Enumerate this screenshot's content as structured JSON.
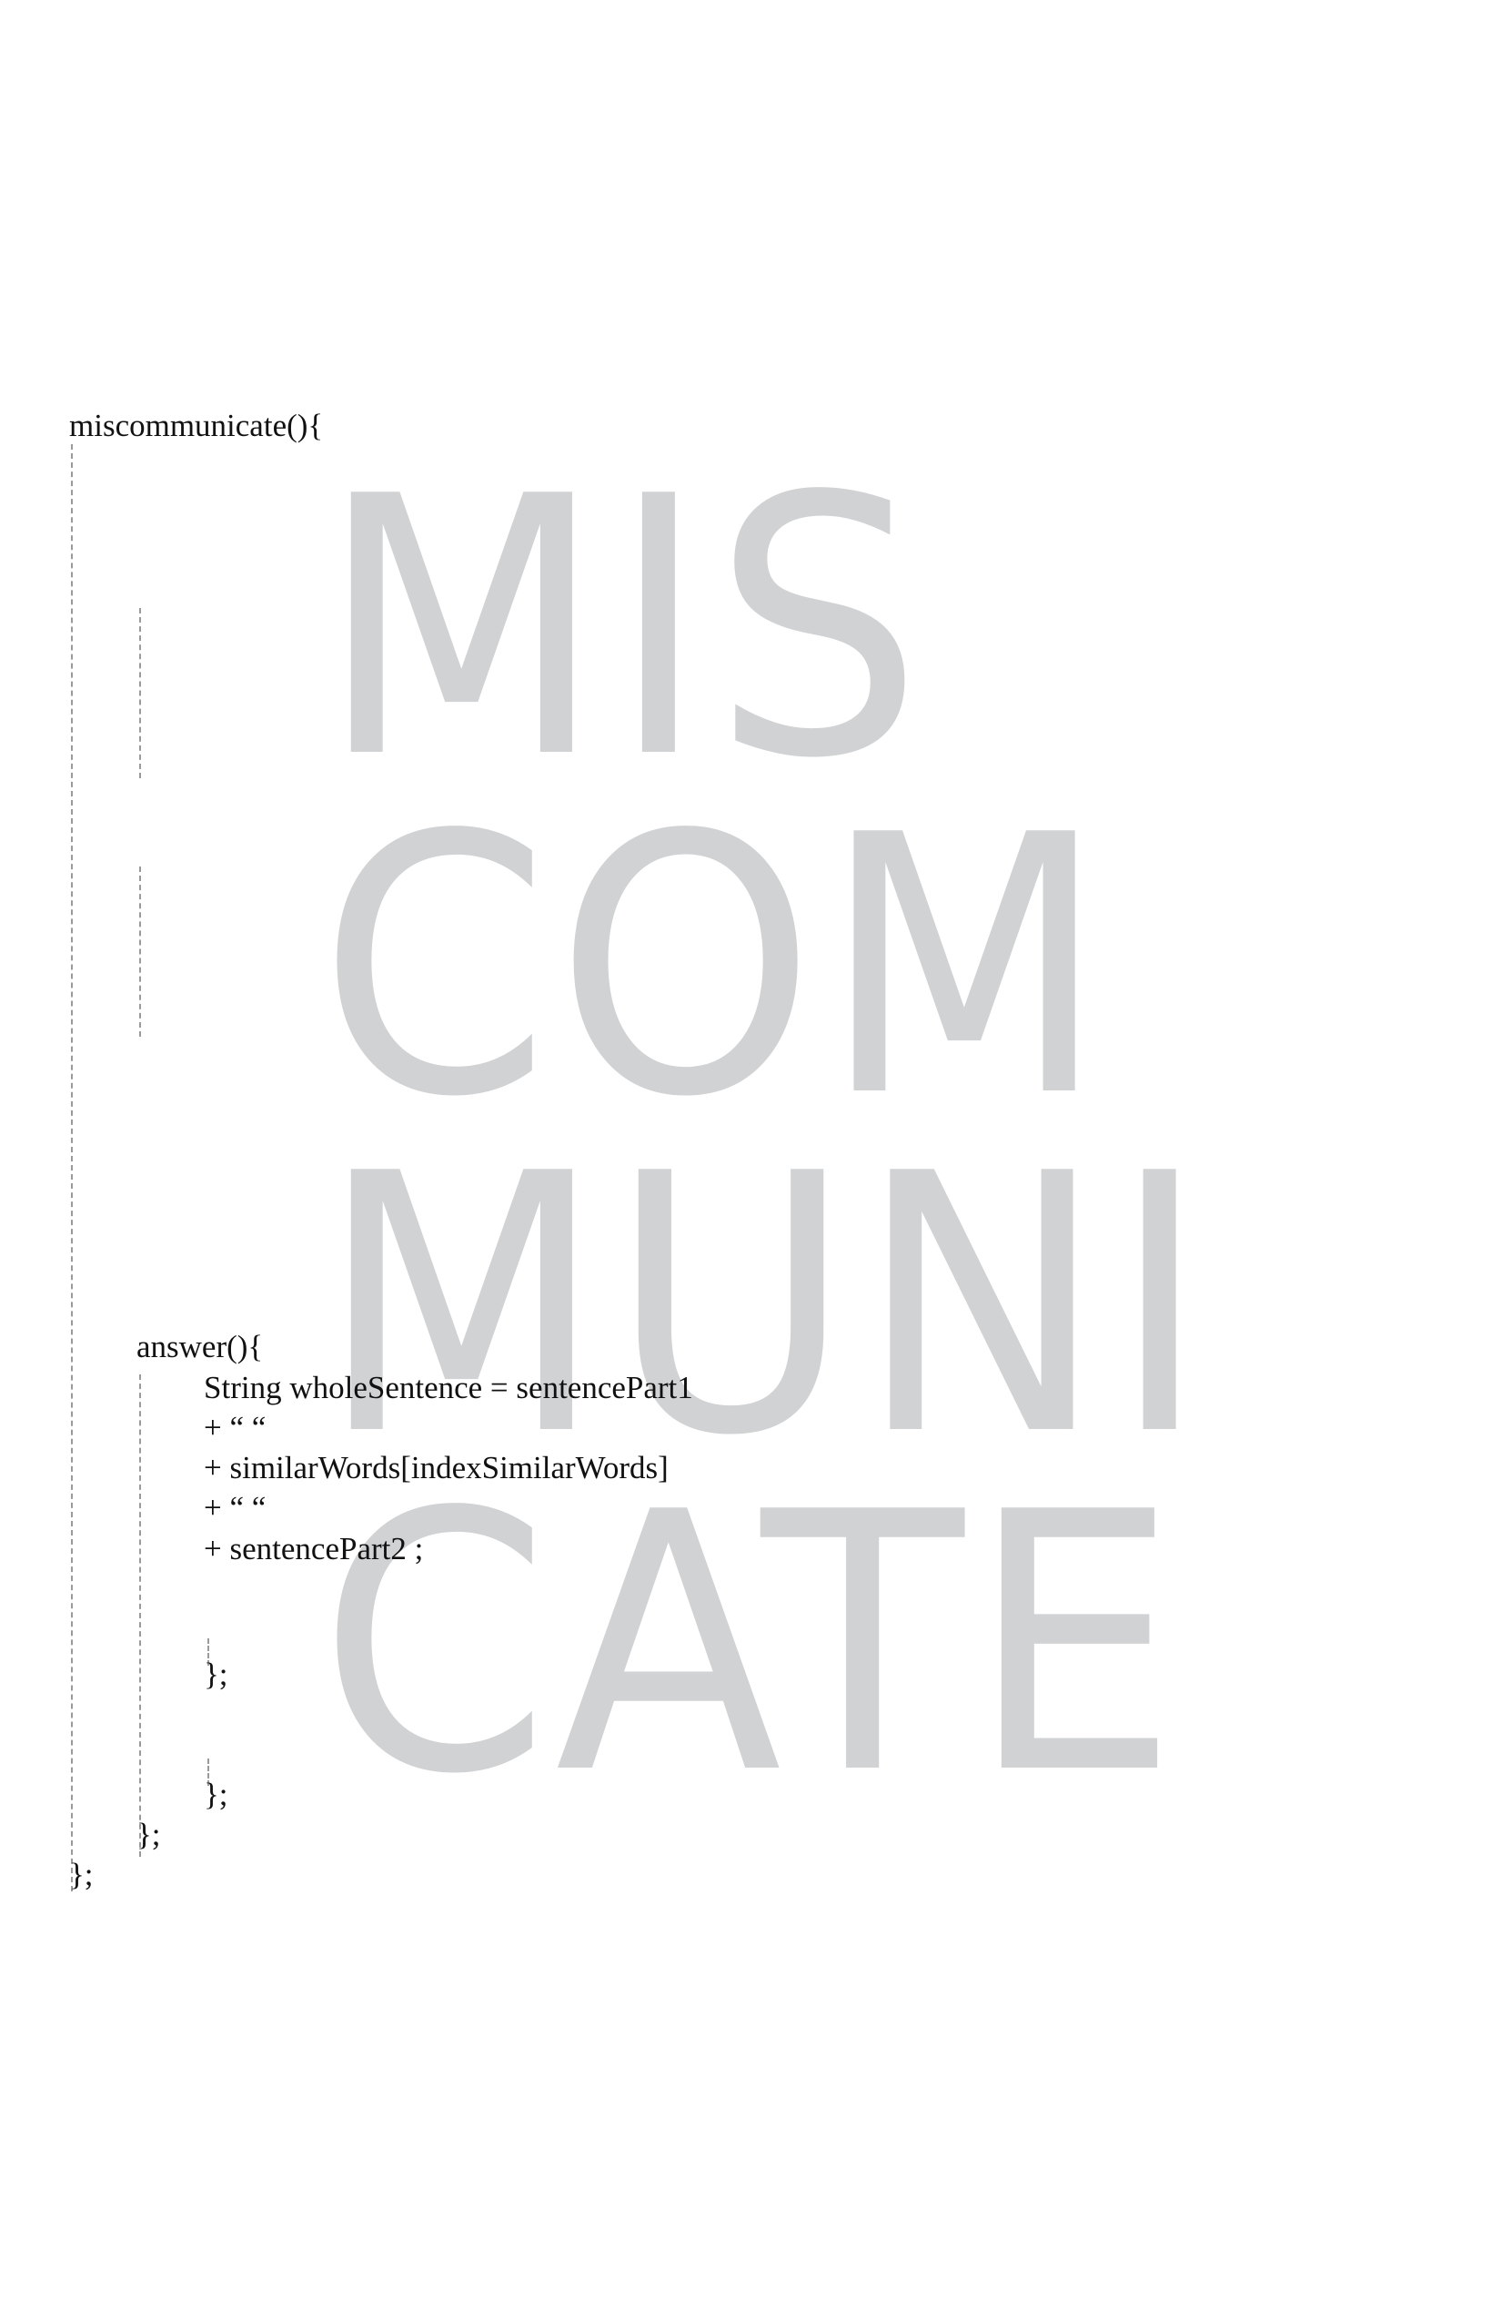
{
  "background": {
    "lines": [
      "MIS",
      "COM",
      "MUNI",
      "CATE"
    ],
    "color": "#d1d2d4"
  },
  "code": {
    "outer_open": "miscommunicate(){",
    "answer_open": "answer(){",
    "line1": "String wholeSentence = sentencePart1",
    "line2": "+ “ “",
    "line3": "+ similarWords[indexSimilarWords]",
    "line4": "+ “ “",
    "line5": "+ sentencePart2 ;",
    "close_inner_1": "};",
    "close_inner_2": "};",
    "close_answer": "};",
    "close_outer": "};"
  }
}
